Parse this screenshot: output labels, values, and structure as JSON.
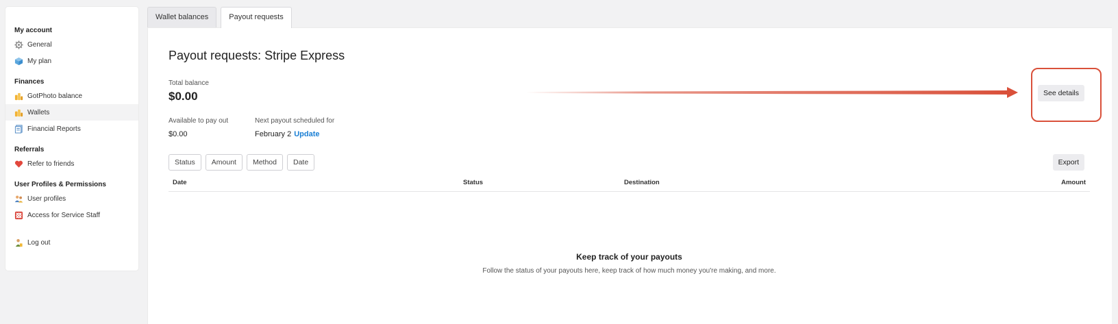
{
  "sidebar": {
    "sections": [
      {
        "heading": "My account",
        "items": [
          {
            "label": "General",
            "icon": "gear-icon"
          },
          {
            "label": "My plan",
            "icon": "cube-icon"
          }
        ]
      },
      {
        "heading": "Finances",
        "items": [
          {
            "label": "GotPhoto balance",
            "icon": "coins-icon"
          },
          {
            "label": "Wallets",
            "icon": "wallet-coins-icon",
            "active": true
          },
          {
            "label": "Financial Reports",
            "icon": "report-icon"
          }
        ]
      },
      {
        "heading": "Referrals",
        "items": [
          {
            "label": "Refer to friends",
            "icon": "heart-icon"
          }
        ]
      },
      {
        "heading": "User Profiles & Permissions",
        "items": [
          {
            "label": "User profiles",
            "icon": "users-icon"
          },
          {
            "label": "Access for Service Staff",
            "icon": "lifebuoy-icon"
          }
        ]
      }
    ],
    "logout": {
      "label": "Log out",
      "icon": "logout-user-icon"
    }
  },
  "tabs": [
    {
      "label": "Wallet balances",
      "active": false
    },
    {
      "label": "Payout requests",
      "active": true
    }
  ],
  "main": {
    "title": "Payout requests: Stripe Express",
    "total_balance_label": "Total balance",
    "total_balance_value": "$0.00",
    "available_label": "Available to pay out",
    "available_value": "$0.00",
    "next_payout_label": "Next payout scheduled for",
    "next_payout_date": "February 2",
    "update_label": "Update",
    "see_details_label": "See details",
    "filters": [
      "Status",
      "Amount",
      "Method",
      "Date"
    ],
    "export_label": "Export",
    "columns": [
      "Date",
      "Status",
      "Destination",
      "Amount"
    ],
    "empty_title": "Keep track of your payouts",
    "empty_subtitle": "Follow the status of your payouts here, keep track of how much money you're making, and more."
  },
  "colors": {
    "accent_link": "#1a7fd4",
    "annotation": "#d9503a",
    "active_item_bg": "#f3f3f4"
  }
}
